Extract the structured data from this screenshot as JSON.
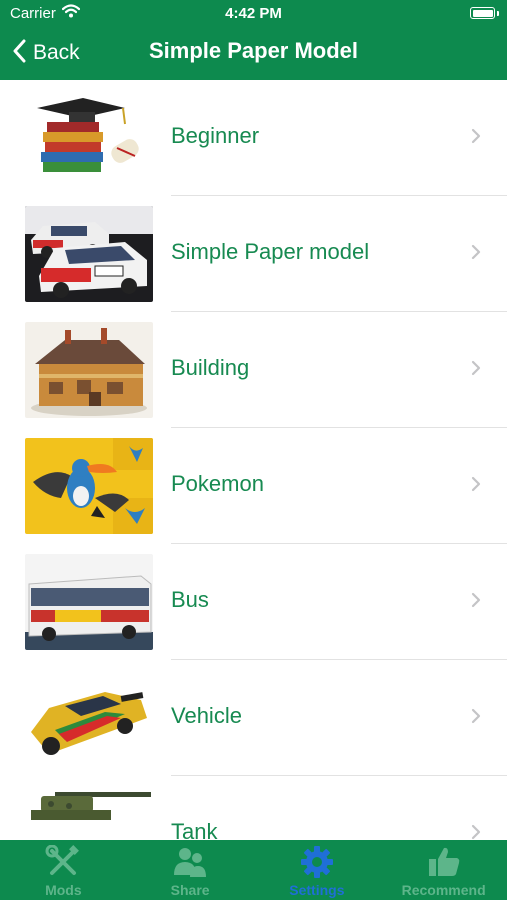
{
  "status_bar": {
    "carrier": "Carrier",
    "time": "4:42 PM"
  },
  "nav": {
    "back_label": "Back",
    "title": "Simple Paper Model"
  },
  "list": {
    "items": [
      {
        "label": "Beginner",
        "thumbnail": "books-graduation-cap-image"
      },
      {
        "label": "Simple Paper model",
        "thumbnail": "paper-cars-image"
      },
      {
        "label": "Building",
        "thumbnail": "paper-house-image"
      },
      {
        "label": "Pokemon",
        "thumbnail": "toucan-pokemon-image"
      },
      {
        "label": "Bus",
        "thumbnail": "paper-bus-image"
      },
      {
        "label": "Vehicle",
        "thumbnail": "race-car-image"
      },
      {
        "label": "Tank",
        "thumbnail": "tank-image"
      }
    ]
  },
  "tabbar": {
    "tabs": [
      {
        "label": "Mods",
        "icon": "tools-icon",
        "active": false
      },
      {
        "label": "Share",
        "icon": "users-icon",
        "active": false
      },
      {
        "label": "Settings",
        "icon": "gear-icon",
        "active": true
      },
      {
        "label": "Recommend",
        "icon": "thumbs-up-icon",
        "active": false
      }
    ]
  },
  "colors": {
    "brand_green": "#0d8a4e",
    "label_green": "#178a51",
    "active_tab": "#1f6fd6",
    "inactive_tab": "#5db58a"
  }
}
